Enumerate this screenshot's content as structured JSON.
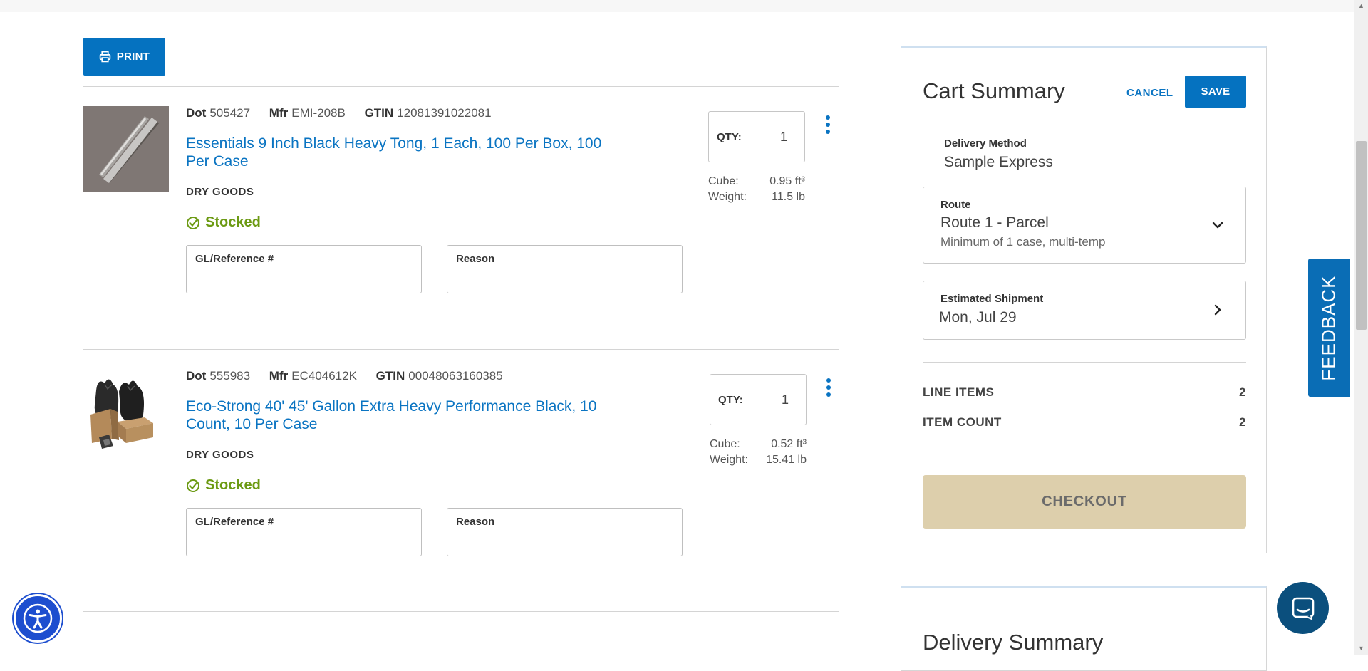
{
  "toolbar": {
    "print_label": "PRINT"
  },
  "items": [
    {
      "dot_label": "Dot",
      "dot": "505427",
      "mfr_label": "Mfr",
      "mfr": "EMI-208B",
      "gtin_label": "GTIN",
      "gtin": "12081391022081",
      "title": "Essentials 9 Inch Black Heavy Tong, 1 Each, 100 Per Box, 100 Per Case",
      "category": "DRY GOODS",
      "status": "Stocked",
      "gl_label": "GL/Reference #",
      "reason_label": "Reason",
      "qty_label": "QTY:",
      "qty": "1",
      "cube_label": "Cube:",
      "cube": "0.95 ft³",
      "weight_label": "Weight:",
      "weight": "11.5 lb"
    },
    {
      "dot_label": "Dot",
      "dot": "555983",
      "mfr_label": "Mfr",
      "mfr": "EC404612K",
      "gtin_label": "GTIN",
      "gtin": "00048063160385",
      "title": "Eco-Strong 40' 45' Gallon Extra Heavy Performance Black, 10 Count, 10 Per Case",
      "category": "DRY GOODS",
      "status": "Stocked",
      "gl_label": "GL/Reference #",
      "reason_label": "Reason",
      "qty_label": "QTY:",
      "qty": "1",
      "cube_label": "Cube:",
      "cube": "0.52 ft³",
      "weight_label": "Weight:",
      "weight": "15.41 lb"
    }
  ],
  "cart": {
    "title": "Cart Summary",
    "cancel_label": "CANCEL",
    "save_label": "SAVE",
    "delivery_method_label": "Delivery Method",
    "delivery_method": "Sample Express",
    "route_label": "Route",
    "route": "Route 1 - Parcel",
    "route_note": "Minimum of 1 case, multi-temp",
    "shipment_label": "Estimated Shipment",
    "shipment": "Mon, Jul 29",
    "line_items_label": "LINE ITEMS",
    "line_items": "2",
    "item_count_label": "ITEM COUNT",
    "item_count": "2",
    "checkout_label": "CHECKOUT"
  },
  "delivery_summary": {
    "title": "Delivery Summary"
  },
  "feedback_label": "FEEDBACK",
  "colors": {
    "accent": "#0572c0",
    "link": "#0a74c2",
    "stock": "#6c9a13",
    "checkout_bg": "#ddcfac"
  }
}
